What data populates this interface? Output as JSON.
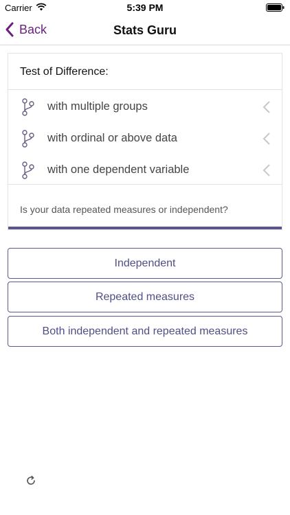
{
  "status": {
    "carrier": "Carrier",
    "time": "5:39 PM"
  },
  "nav": {
    "back_label": "Back",
    "title": "Stats Guru"
  },
  "card": {
    "title": "Test of Difference:",
    "criteria": [
      {
        "label": "with multiple groups",
        "icon": "branch-icon"
      },
      {
        "label": "with ordinal or above data",
        "icon": "branch-icon"
      },
      {
        "label": "with one dependent variable",
        "icon": "branch-icon"
      }
    ],
    "question": "Is your data repeated measures or independent?"
  },
  "options": [
    "Independent",
    "Repeated measures",
    "Both independent and repeated measures"
  ],
  "colors": {
    "accent": "#6b1f7c",
    "button": "#4f4e86",
    "bar": "#595687"
  }
}
